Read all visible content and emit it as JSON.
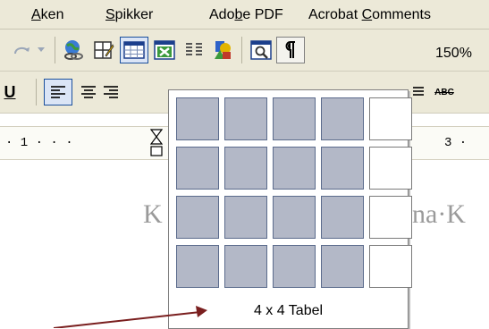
{
  "menubar": {
    "items": [
      {
        "label": "Aken",
        "mnemonic": "A"
      },
      {
        "label": "Spikker",
        "mnemonic": "S"
      },
      {
        "label": "Adobe PDF",
        "mnemonic": "b"
      },
      {
        "label": "Acrobat Comments",
        "mnemonic": "C"
      }
    ]
  },
  "toolbar": {
    "zoom_value": "150%",
    "icons": [
      "redo-icon",
      "redo-dropdown-icon",
      "hyperlink-icon",
      "tables-borders-icon",
      "insert-table-icon",
      "insert-excel-icon",
      "columns-icon",
      "drawing-icon",
      "document-map-icon",
      "show-hide-icon"
    ]
  },
  "format_toolbar": {
    "underline_label": "U",
    "abc_label": "ABC"
  },
  "ruler": {
    "left_marks": "· 1 · · ·",
    "right_marks": "3 ·"
  },
  "document": {
    "left_fragment": "K",
    "right_fragment": "na·K"
  },
  "table_picker": {
    "columns": 5,
    "rows": 4,
    "selected_columns": 4,
    "selected_rows": 4,
    "status_label": "4 x 4 Tabel"
  },
  "annotation": {
    "arrow_color": "#7a1f1f"
  }
}
